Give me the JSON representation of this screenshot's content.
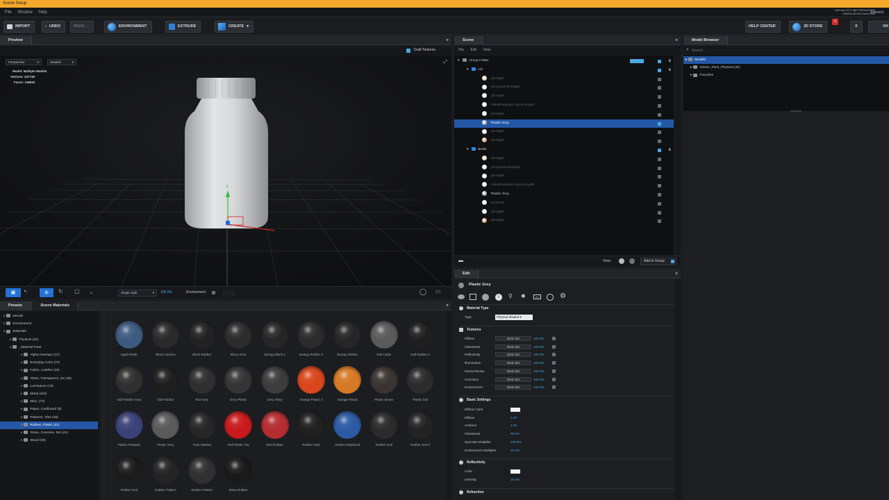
{
  "window": {
    "title": "Scene Setup",
    "gpu_line1": "GeForce GTX 980 Ti/PCIe/SSE2",
    "gpu_line2": "436226.46 M/S Vram 6GB",
    "element_label": "Element"
  },
  "menu": [
    "File",
    "Window",
    "Help"
  ],
  "toolbar": {
    "import": "IMPORT",
    "undo": "UNDO",
    "redo": "REDO",
    "environment": "ENVIRONMENT",
    "extrude": "EXTRUDE",
    "create": "CREATE",
    "help_center": "HELP CENTER",
    "store": "3D STORE",
    "store_badge": "2",
    "close": "X",
    "ok": "OK"
  },
  "preview": {
    "header": "Preview",
    "draft_textures": "Draft Textures",
    "camera_mode": "Perspective",
    "shading_mode": "Shaded",
    "model_label": "Model:",
    "model_value": "Multiple Models",
    "vertices_label": "Vertices:",
    "vertices_value": "437748",
    "faces_label": "Faces:",
    "faces_value": "146922",
    "axis_y": "Y",
    "light_mode": "Single Light",
    "light_pct": "100.0%",
    "environment_label": "Environment"
  },
  "scene": {
    "header": "Scene",
    "menu": [
      "File",
      "Edit",
      "View"
    ],
    "rows": [
      {
        "label": "Group Folder",
        "kind": "folder",
        "indent": 0,
        "xbtn": true
      },
      {
        "label": "Lid",
        "kind": "group",
        "indent": 1,
        "xbtn": true
      },
      {
        "label": "phong58",
        "kind": "mat",
        "color": "#d6c28a",
        "indent": 2
      },
      {
        "label": "phong118-phong58",
        "kind": "mat",
        "color": "#d9d9d9",
        "indent": 2
      },
      {
        "label": "phong58",
        "kind": "mat",
        "color": "#d9d9d9",
        "indent": 2
      },
      {
        "label": "initialShadingGroup-phong58",
        "kind": "mat",
        "color": "#d9d9d9",
        "indent": 2
      },
      {
        "label": "phong58",
        "kind": "mat",
        "color": "#d9d9d9",
        "indent": 2
      },
      {
        "label": "Plastic Grey",
        "kind": "mat",
        "color": "#777b80",
        "indent": 2,
        "selected": true
      },
      {
        "label": "phong86",
        "kind": "mat",
        "color": "#d9d9d9",
        "indent": 2
      },
      {
        "label": "phong58",
        "kind": "mat",
        "color": "#b56a2f",
        "indent": 2
      },
      {
        "label": "Bottle",
        "kind": "group",
        "indent": 1,
        "xbtn": true
      },
      {
        "label": "phong58",
        "kind": "mat",
        "color": "#d6c28a",
        "indent": 2
      },
      {
        "label": "phong118-phong58",
        "kind": "mat",
        "color": "#d9d9d9",
        "indent": 2
      },
      {
        "label": "phong58",
        "kind": "mat",
        "color": "#d9d9d9",
        "indent": 2
      },
      {
        "label": "initialShadingGroup-phong58",
        "kind": "mat",
        "color": "#d9d9d9",
        "indent": 2
      },
      {
        "label": "Plastic Grey",
        "kind": "mat",
        "color": "#777b80",
        "indent": 2
      },
      {
        "label": "lambert5",
        "kind": "mat",
        "color": "#d9d9d9",
        "indent": 2
      },
      {
        "label": "phong86",
        "kind": "mat",
        "color": "#d9d9d9",
        "indent": 2
      },
      {
        "label": "phong58",
        "kind": "mat",
        "color": "#b56a2f",
        "indent": 2
      }
    ],
    "view_label": "View:",
    "add_to_group": "Add to Group"
  },
  "model_browser": {
    "header": "Model Browser",
    "search_placeholder": "Search...",
    "items": [
      {
        "label": "Models",
        "indent": 0,
        "selected": true
      },
      {
        "label": "Starter_Pack_Physical (42)",
        "indent": 1
      },
      {
        "label": "Favorites",
        "indent": 1
      }
    ]
  },
  "library": {
    "tabs": [
      "Presets",
      "Scene Materials"
    ],
    "tree": [
      {
        "label": "Decals",
        "indent": 0
      },
      {
        "label": "Environment",
        "indent": 0
      },
      {
        "label": "Materials",
        "indent": 0
      },
      {
        "label": "Physical (22)",
        "indent": 1
      },
      {
        "label": "_Material-Pack",
        "indent": 1
      },
      {
        "label": "Alpha Overlays (37)",
        "indent": 2
      },
      {
        "label": "Everyday Color (72)",
        "indent": 2
      },
      {
        "label": "Fabric, Leather (16)",
        "indent": 2
      },
      {
        "label": "Glass, Transparent, Ice (36)",
        "indent": 2
      },
      {
        "label": "Luminance (13)",
        "indent": 2
      },
      {
        "label": "Metal (116)",
        "indent": 2
      },
      {
        "label": "Misc. (72)",
        "indent": 2
      },
      {
        "label": "Paper, Cardboard (9)",
        "indent": 2
      },
      {
        "label": "Patterns, Tiles (29)",
        "indent": 2
      },
      {
        "label": "Rubber, Plastic (31)",
        "indent": 2,
        "selected": true
      },
      {
        "label": "Stone, Concrete, Dirt (41)",
        "indent": 2
      },
      {
        "label": "Wood (28)",
        "indent": 2
      }
    ],
    "materials": [
      {
        "label": "Aged Plastic",
        "color": "#3d5b80"
      },
      {
        "label": "Black Camera",
        "color": "#2a2a2a"
      },
      {
        "label": "Black Rubber",
        "color": "#222222"
      },
      {
        "label": "Blurry Grey",
        "color": "#2c2c2c"
      },
      {
        "label": "Bumpy Black 2",
        "color": "#262626"
      },
      {
        "label": "Bumpy Rubber 2",
        "color": "#2b2b2b"
      },
      {
        "label": "Bumpy Rubber",
        "color": "#262626"
      },
      {
        "label": "Dull Cable",
        "color": "#5a5a5a"
      },
      {
        "label": "Dull Rubber 2",
        "color": "#1f1f1f"
      },
      {
        "label": "Dull Rubber Grey",
        "color": "#303030"
      },
      {
        "label": "Dull Rubber",
        "color": "#1e1e1e"
      },
      {
        "label": "Flat Grey",
        "color": "#2f2f2f"
      },
      {
        "label": "Grey Plastic",
        "color": "#353535"
      },
      {
        "label": "Grey Shiny",
        "color": "#3c3c3c"
      },
      {
        "label": "Orange Plastic 2",
        "color": "#d8461b"
      },
      {
        "label": "Orange Plastic",
        "color": "#d77a25"
      },
      {
        "label": "Plastic Brown",
        "color": "#3a3432"
      },
      {
        "label": "Plastic Dull",
        "color": "#2c2c2c"
      },
      {
        "label": "Plastic Fantastic",
        "color": "#3a4277"
      },
      {
        "label": "Plastic Grey",
        "color": "#5a5a5a"
      },
      {
        "label": "Pock Marked",
        "color": "#262626"
      },
      {
        "label": "Red Plastic Toy",
        "color": "#c8191c"
      },
      {
        "label": "Red Rubber",
        "color": "#b52d30"
      },
      {
        "label": "Rubber Dark",
        "color": "#202020"
      },
      {
        "label": "Rubber Displaced",
        "color": "#2d5aa4"
      },
      {
        "label": "Rubber Dull",
        "color": "#2b2b2b"
      },
      {
        "label": "Rubber Grid 2",
        "color": "#232323"
      },
      {
        "label": "Rubber Grid",
        "color": "#1c1c1c"
      },
      {
        "label": "Rubber Pattern",
        "color": "#242424"
      },
      {
        "label": "Rubber Pattern",
        "color": "#303030"
      },
      {
        "label": "Shiny Rubber",
        "color": "#1a1a1a"
      }
    ]
  },
  "edit": {
    "header": "Edit",
    "material_name": "Plastic Grey",
    "material_type_section": "Material Type",
    "type_label": "Type",
    "type_value": "Physical Shaded",
    "textures_section": "Textures",
    "textures": [
      {
        "label": "Diffuse",
        "value": "None Set",
        "pct": "100.0%"
      },
      {
        "label": "Glossiness",
        "value": "None Set",
        "pct": "100.0%"
      },
      {
        "label": "Reflectivity",
        "value": "None Set",
        "pct": "100.0%"
      },
      {
        "label": "Illumination",
        "value": "None Set",
        "pct": "100.0%"
      },
      {
        "label": "Normal Bump",
        "value": "None Set",
        "pct": "100.0%"
      },
      {
        "label": "Occlusion",
        "value": "None Set",
        "pct": "100.0%"
      },
      {
        "label": "Environment",
        "value": "None Set",
        "pct": "100.0%"
      }
    ],
    "basic_section": "Basic Settings",
    "basic": [
      {
        "label": "Diffuse Color",
        "value": ""
      },
      {
        "label": "Diffuse",
        "value": "1.00"
      },
      {
        "label": "Ambient",
        "value": "1.00"
      },
      {
        "label": "Glossiness",
        "value": "55.0%"
      },
      {
        "label": "Specular Multiplier",
        "value": "100.0%"
      },
      {
        "label": "Environment Multiplier",
        "value": "15.0%"
      }
    ],
    "reflect_section": "Reflectivity",
    "reflect": [
      {
        "label": "Color",
        "value": ""
      },
      {
        "label": "Intensity",
        "value": "15.0%"
      }
    ],
    "refraction_section": "Refraction"
  }
}
